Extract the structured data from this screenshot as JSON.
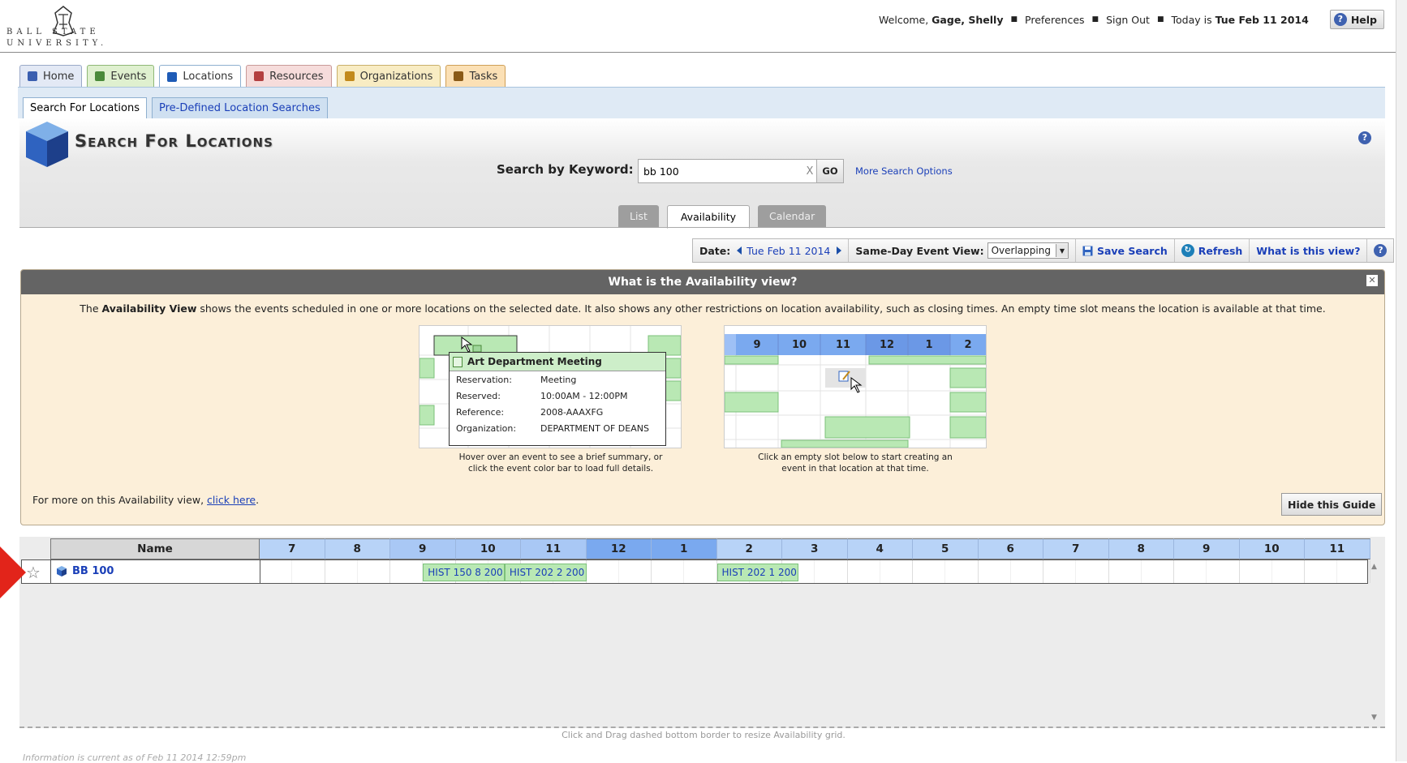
{
  "logo": {
    "line1": "BALL STATE",
    "line2": "UNIVERSITY."
  },
  "user": {
    "welcome": "Welcome,",
    "name": "Gage, Shelly",
    "preferences": "Preferences",
    "sign_out": "Sign Out",
    "today_label": "Today is",
    "today": "Tue Feb 11 2014",
    "help": "Help"
  },
  "main_tabs": [
    {
      "label": "Home",
      "bg": "#e3e9f5",
      "border": "#9aa9c8",
      "icon": "#3b5fb0"
    },
    {
      "label": "Events",
      "bg": "#dff0cf",
      "border": "#8fb876",
      "icon": "#4a8a3a"
    },
    {
      "label": "Locations",
      "bg": "#ffffff",
      "border": "#8fb0d0",
      "icon": "#1e5bb6"
    },
    {
      "label": "Resources",
      "bg": "#f6dcdb",
      "border": "#c99a98",
      "icon": "#b34040"
    },
    {
      "label": "Organizations",
      "bg": "#f8ecc3",
      "border": "#c9b06a",
      "icon": "#c28a1c"
    },
    {
      "label": "Tasks",
      "bg": "#fbe0b5",
      "border": "#cf9f57",
      "icon": "#8a5a18"
    }
  ],
  "sub_tabs": [
    {
      "label": "Search For Locations",
      "active": true
    },
    {
      "label": "Pre-Defined Location Searches",
      "active": false
    }
  ],
  "page_title": "Search For Locations",
  "search": {
    "label": "Search by Keyword:",
    "value": "bb 100",
    "clear": "X",
    "go": "GO",
    "more": "More Search Options"
  },
  "view_tabs": [
    {
      "label": "List",
      "active": false
    },
    {
      "label": "Availability",
      "active": true
    },
    {
      "label": "Calendar",
      "active": false
    }
  ],
  "toolbar": {
    "date_label": "Date:",
    "date": "Tue Feb 11 2014",
    "same_day_label": "Same-Day Event View:",
    "same_day_value": "Overlapping",
    "save": "Save Search",
    "refresh": "Refresh",
    "what": "What is this view?"
  },
  "guide": {
    "title": "What is the Availability view?",
    "intro_pre": "The",
    "intro_bold": "Availability View",
    "intro_rest": "shows the events scheduled in one or more locations on the selected date. It also shows any other restrictions on location availability, such as closing times. An empty time slot means the location is available at that time.",
    "popup": {
      "title": "Art Department Meeting",
      "rows": [
        {
          "k": "Reservation:",
          "v": "Meeting"
        },
        {
          "k": "Reserved:",
          "v": "10:00AM - 12:00PM"
        },
        {
          "k": "Reference:",
          "v": "2008-AAAXFG"
        },
        {
          "k": "Organization:",
          "v": "DEPARTMENT OF DEANS"
        }
      ]
    },
    "caption1": "Hover over an event to see a brief summary, or click the event color bar to load full details.",
    "demo2_hours": [
      "9",
      "10",
      "11",
      "12",
      "1",
      "2"
    ],
    "caption2": "Click an empty slot below to start creating an event in that location at that time.",
    "more_pre": "For more on this Availability view,",
    "more_link": "click here",
    "more_post": ".",
    "hide": "Hide this Guide"
  },
  "grid": {
    "name_header": "Name",
    "hours": [
      "7",
      "8",
      "9",
      "10",
      "11",
      "12",
      "1",
      "2",
      "3",
      "4",
      "5",
      "6",
      "7",
      "8",
      "9",
      "10",
      "11"
    ],
    "location": "BB 100",
    "events": [
      {
        "label": "HIST 150 8 200",
        "start": 9.5,
        "end": 10.75
      },
      {
        "label": "HIST 202 2 200",
        "start": 10.75,
        "end": 12.0
      },
      {
        "label": "HIST 202 1 200",
        "start": 14.0,
        "end": 15.25
      }
    ]
  },
  "resize_note": "Click and Drag dashed bottom border to resize Availability grid.",
  "info_note": "Information is current as of Feb 11 2014 12:59pm"
}
